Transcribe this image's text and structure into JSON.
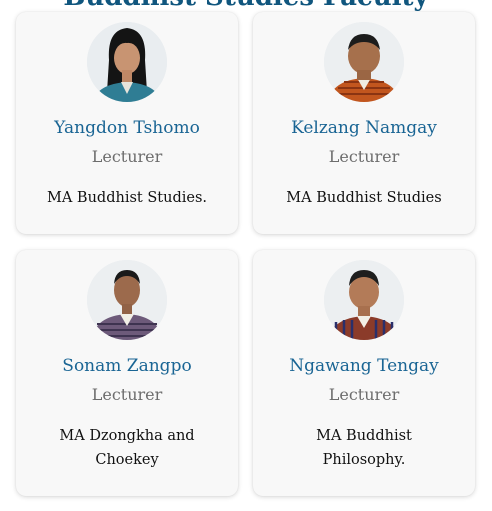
{
  "heading": "Buddhist Studies Faculty",
  "staff": [
    {
      "name": "Yangdon Tshomo",
      "role": "Lecturer",
      "qualification": "MA Buddhist Studies.",
      "photo": "person-photo-icon"
    },
    {
      "name": "Kelzang Namgay",
      "role": "Lecturer",
      "qualification": "MA Buddhist Studies",
      "photo": "person-photo-icon"
    },
    {
      "name": "Sonam Zangpo",
      "role": "Lecturer",
      "qualification": "MA Dzongkha and Choekey",
      "photo": "person-photo-icon"
    },
    {
      "name": "Ngawang Tengay",
      "role": "Lecturer",
      "qualification": "MA Buddhist Philosophy.",
      "photo": "person-photo-icon"
    }
  ],
  "colors": {
    "name": "#1a6594",
    "role": "#6d6d6d",
    "card": "#f8f8f8"
  }
}
